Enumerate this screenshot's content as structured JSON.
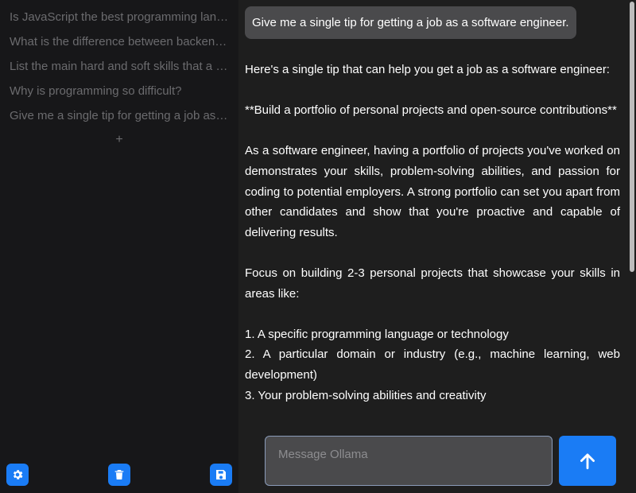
{
  "sidebar": {
    "history": [
      {
        "label": "Is JavaScript the best programming language?"
      },
      {
        "label": "What is the difference between backend and frontend?"
      },
      {
        "label": "List the main hard and soft skills that a software engineer needs"
      },
      {
        "label": "Why is programming so difficult?"
      },
      {
        "label": "Give me a single tip for getting a job as a software engineer."
      }
    ],
    "add_label": "+",
    "buttons": {
      "settings_icon": "gear-icon",
      "delete_icon": "trash-icon",
      "save_icon": "floppy-disk-icon"
    }
  },
  "chat": {
    "user_message": "Give me a single tip for getting a job as a software engineer.",
    "assistant_paragraphs": [
      "Here's a single tip that can help you get a job as a software engineer:",
      "**Build a portfolio of personal projects and open-source contributions**",
      "As a software engineer, having a portfolio of projects you've worked on demonstrates your skills, problem-solving abilities, and passion for coding to potential employers. A strong portfolio can set you apart from other candidates and show that you're proactive and capable of delivering results.",
      "Focus on building 2-3 personal projects that showcase your skills in areas like:"
    ],
    "assistant_list": [
      "1. A specific programming language or technology",
      "2. A particular domain or industry (e.g., machine learning, web development)",
      "3. Your problem-solving abilities and creativity"
    ]
  },
  "composer": {
    "placeholder": "Message Ollama",
    "send_icon": "arrow-up-icon"
  },
  "colors": {
    "accent": "#1a7cf5",
    "sidebar_bg": "#171719",
    "main_bg": "#1e1e1e",
    "bubble_bg": "#4a4a4c"
  }
}
